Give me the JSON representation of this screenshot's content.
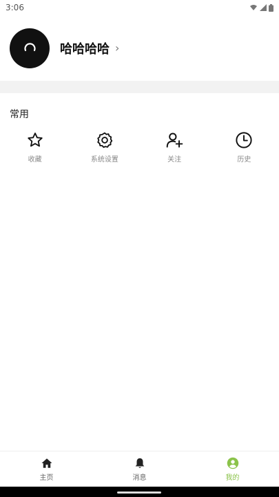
{
  "status_bar": {
    "time": "3:06"
  },
  "profile": {
    "username": "哈哈哈哈",
    "chevron": "›"
  },
  "section": {
    "title": "常用"
  },
  "shortcuts": [
    {
      "label": "收藏",
      "icon": "star-icon"
    },
    {
      "label": "系统设置",
      "icon": "gear-icon"
    },
    {
      "label": "关注",
      "icon": "add-user-icon"
    },
    {
      "label": "历史",
      "icon": "clock-icon"
    }
  ],
  "bottom_nav": {
    "active_color": "#8bc34a",
    "items": [
      {
        "label": "主页",
        "icon": "home-icon"
      },
      {
        "label": "消息",
        "icon": "bell-icon"
      },
      {
        "label": "我的",
        "icon": "user-circle-icon",
        "active": true
      }
    ]
  }
}
